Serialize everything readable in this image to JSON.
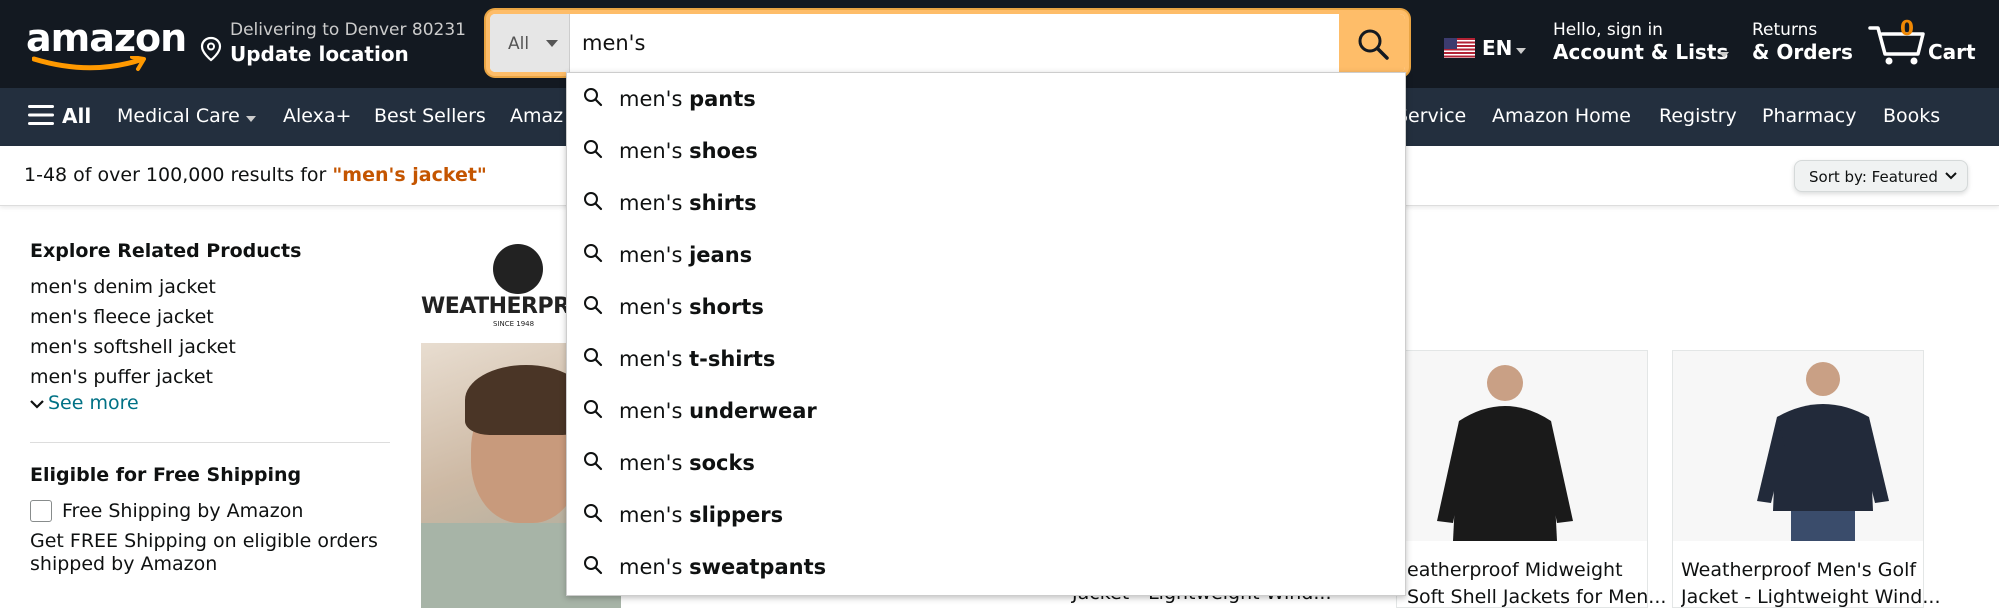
{
  "header": {
    "logo_text": "amazon",
    "location_line1": "Delivering to Denver 80231",
    "location_line2": "Update location",
    "search_category": "All",
    "search_value": "men's",
    "language": "EN",
    "account_line1": "Hello, sign in",
    "account_line2": "Account & Lists",
    "orders_line1": "Returns",
    "orders_line2": "& Orders",
    "cart_count": "0",
    "cart_label": "Cart"
  },
  "subnav": {
    "all_label": "All",
    "items": [
      "Medical Care",
      "Alexa+",
      "Best Sellers",
      "Amaz",
      "Service",
      "Amazon Home",
      "Registry",
      "Pharmacy",
      "Books"
    ]
  },
  "results": {
    "summary": "1-48 of over 100,000 results for ",
    "query": "\"men's jacket\"",
    "sort_label": "Sort by:",
    "sort_value": "Featured"
  },
  "sidebar": {
    "related_heading": "Explore Related Products",
    "related_links": [
      "men's denim jacket",
      "men's fleece jacket",
      "men's softshell jacket",
      "men's puffer jacket"
    ],
    "see_more": "See more",
    "shipping_heading": "Eligible for Free Shipping",
    "shipping_checkbox": "Free Shipping by Amazon",
    "shipping_note": "Get FREE Shipping on eligible orders shipped by Amazon"
  },
  "brand": {
    "name": "WEATHERPR",
    "since": "SINCE 1948"
  },
  "products": [
    {
      "title_line1": "Jacket - Lightweight Wind..."
    },
    {
      "title_line1": "eatherproof Midweight",
      "title_line2": "Soft Shell Jackets for Men..."
    },
    {
      "title_line1": "Weatherproof Men's Golf",
      "title_line2": "Jacket - Lightweight Wind..."
    }
  ],
  "suggestions": [
    {
      "prefix": "men's ",
      "suffix": "pants"
    },
    {
      "prefix": "men's ",
      "suffix": "shoes"
    },
    {
      "prefix": "men's ",
      "suffix": "shirts"
    },
    {
      "prefix": "men's ",
      "suffix": "jeans"
    },
    {
      "prefix": "men's ",
      "suffix": "shorts"
    },
    {
      "prefix": "men's ",
      "suffix": "t-shirts"
    },
    {
      "prefix": "men's ",
      "suffix": "underwear"
    },
    {
      "prefix": "men's ",
      "suffix": "socks"
    },
    {
      "prefix": "men's ",
      "suffix": "slippers"
    },
    {
      "prefix": "men's ",
      "suffix": "sweatpants"
    }
  ],
  "colors": {
    "header_bg": "#131921",
    "subnav_bg": "#232f3e",
    "search_button": "#febd69",
    "cart_count": "#f08804",
    "query_highlight": "#c45500",
    "link": "#007185"
  }
}
